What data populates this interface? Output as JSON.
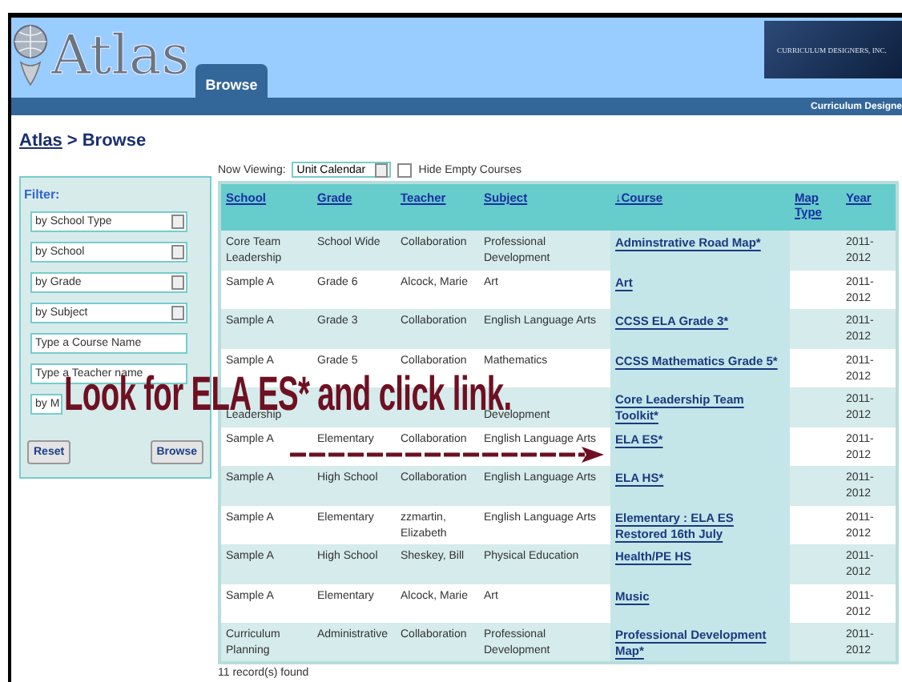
{
  "header": {
    "logo_text": "Atlas",
    "tabs": [
      {
        "label": "Browse",
        "selected": true
      }
    ],
    "brand_text": "CURRICULUM DESIGNERS, INC.",
    "nav_text": "Curriculum Designe"
  },
  "breadcrumb": {
    "link": "Atlas",
    "separator": ">",
    "current": "Browse"
  },
  "filter": {
    "title": "Filter:",
    "fields": [
      {
        "kind": "select",
        "text": "by School Type"
      },
      {
        "kind": "select",
        "text": "by School"
      },
      {
        "kind": "select",
        "text": "by Grade"
      },
      {
        "kind": "select",
        "text": "by Subject"
      },
      {
        "kind": "input",
        "placeholder": "Type a Course Name"
      },
      {
        "kind": "input",
        "placeholder": "Type a Teacher name"
      },
      {
        "kind": "select",
        "text": "by M"
      }
    ],
    "buttons": [
      "Reset",
      "Browse"
    ]
  },
  "toolbar": {
    "label": "Now Viewing:",
    "view": "Unit Calendar",
    "hide_empty": {
      "label": "Hide Empty Courses",
      "checked": false
    }
  },
  "table": {
    "columns": [
      "School",
      "Grade",
      "Teacher",
      "Subject",
      "↓Course",
      "Map Type",
      "Year"
    ],
    "rows": [
      {
        "school": "Core Team Leadership",
        "grade": "School Wide",
        "teacher": "Collaboration",
        "subject": "Professional Development",
        "course": "Adminstrative Road Map*",
        "year": "2011-2012"
      },
      {
        "school": "Sample A",
        "grade": "Grade 6",
        "teacher": "Alcock, Marie",
        "subject": "Art",
        "course": "Art",
        "year": "2011-2012"
      },
      {
        "school": "Sample A",
        "grade": "Grade 3",
        "teacher": "Collaboration",
        "subject": "English Language Arts",
        "course": "CCSS ELA Grade 3*",
        "year": "2011-2012"
      },
      {
        "school": "Sample A",
        "grade": "Grade 5",
        "teacher": "Collaboration",
        "subject": "Mathematics",
        "course": "CCSS Mathematics Grade 5*",
        "year": "2011-2012"
      },
      {
        "school": "Leadership",
        "subject": "Development",
        "course": "Core Leadership Team Toolkit*",
        "year": "2011-2012"
      },
      {
        "school": "Sample A",
        "grade": "Elementary",
        "teacher": "Collaboration",
        "subject": "English Language Arts",
        "course": "ELA ES*",
        "year": "2011-2012"
      },
      {
        "school": "Sample A",
        "grade": "High School",
        "teacher": "Collaboration",
        "subject": "English Language Arts",
        "course": "ELA HS*",
        "year": "2011-2012"
      },
      {
        "school": "Sample A",
        "grade": "Elementary",
        "teacher": "zzmartin, Elizabeth",
        "subject": "English Language Arts",
        "course": "Elementary : ELA ES Restored 16th July",
        "year": "2011-2012"
      },
      {
        "school": "Sample A",
        "grade": "High School",
        "teacher": "Sheskey, Bill",
        "subject": "Physical Education",
        "course": "Health/PE HS",
        "year": "2011-2012"
      },
      {
        "school": "Sample A",
        "grade": "Elementary",
        "teacher": "Alcock, Marie",
        "subject": "Art",
        "course": "Music",
        "year": "2011-2012"
      },
      {
        "school": "Curriculum Planning",
        "grade": "Administrative",
        "teacher": "Collaboration",
        "subject": "Professional Development",
        "course": "Professional Development Map*",
        "year": "2011-2012"
      }
    ],
    "footer": "11 record(s) found"
  },
  "annotation": {
    "text": "Look for ELA ES* and click link."
  }
}
